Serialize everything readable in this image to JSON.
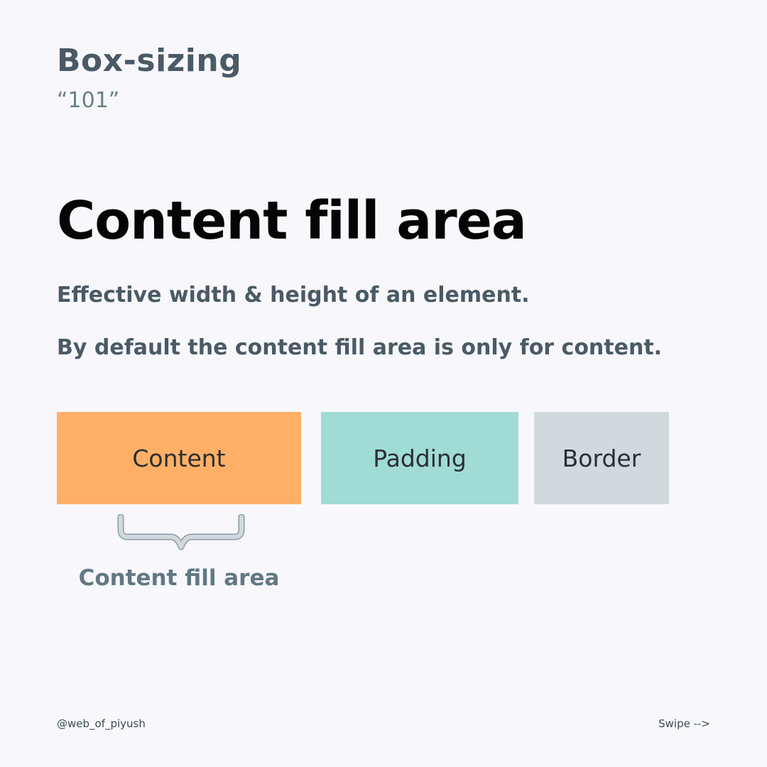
{
  "header": {
    "series_title": "Box-sizing",
    "series_subtitle": "“101”"
  },
  "main": {
    "heading": "Content fill area",
    "description_1": "Effective width & height of an element.",
    "description_2": "By default the content fill area is only for content.",
    "boxes": [
      {
        "label": "Content",
        "color": "#ffb066"
      },
      {
        "label": "Padding",
        "color": "#a0dbd5"
      },
      {
        "label": "Border",
        "color": "#d1d9df"
      }
    ],
    "brace_label": "Content fill area"
  },
  "footer": {
    "handle": "@web_of_piyush",
    "swipe": "Swipe -->"
  }
}
